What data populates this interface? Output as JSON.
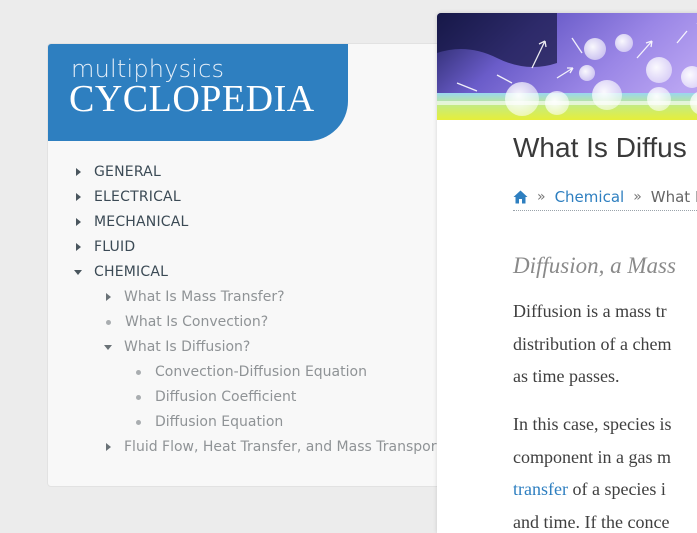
{
  "brand": {
    "top": "multiphysics",
    "main": "CYCLOPEDIA"
  },
  "nav": {
    "items": [
      {
        "label": "GENERAL"
      },
      {
        "label": "ELECTRICAL"
      },
      {
        "label": "MECHANICAL"
      },
      {
        "label": "FLUID"
      },
      {
        "label": "CHEMICAL"
      },
      {
        "label": "What Is Mass Transfer?"
      },
      {
        "label": "What Is Convection?"
      },
      {
        "label": "What Is Diffusion?"
      },
      {
        "label": "Convection-Diffusion Equation"
      },
      {
        "label": "Diffusion Coefficient"
      },
      {
        "label": "Diffusion Equation"
      },
      {
        "label": "Fluid Flow, Heat Transfer, and Mass Transport"
      }
    ]
  },
  "content": {
    "title": "What Is Diffus",
    "breadcrumb": {
      "home_icon": "home-icon",
      "sep": "»",
      "link": "Chemical",
      "current": "What I"
    },
    "subheading": "Diffusion, a Mass",
    "para1": [
      "Diffusion is a mass tr",
      "distribution of a chem",
      "as time passes."
    ],
    "para2": [
      "In this case, species is",
      "component in a gas m"
    ],
    "para2_link": "transfer",
    "para2_after": " of a species i",
    "para2_last": "and time. If the conce"
  },
  "colors": {
    "accent": "#2e7fc0",
    "background": "#ececec"
  }
}
